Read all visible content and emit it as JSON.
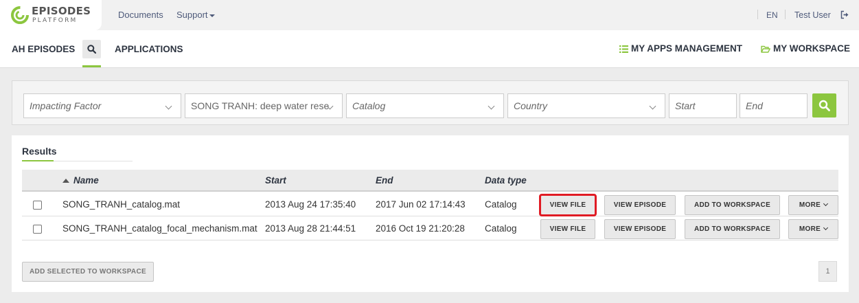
{
  "header": {
    "logo_line1": "EPISODES",
    "logo_line2": "PLATFORM",
    "links": [
      "Documents",
      "Support"
    ],
    "language": "EN",
    "user": "Test User"
  },
  "nav": {
    "left": [
      "AH EPISODES",
      "APPLICATIONS"
    ],
    "right": [
      "MY APPS MANAGEMENT",
      "MY WORKSPACE"
    ],
    "active": "search"
  },
  "filters": {
    "impacting_factor": "Impacting Factor",
    "episode": "SONG TRANH: deep water rese",
    "catalog": "Catalog",
    "country": "Country",
    "start": "Start",
    "end": "End"
  },
  "results": {
    "title": "Results",
    "columns": [
      "Name",
      "Start",
      "End",
      "Data type"
    ],
    "rows": [
      {
        "name": "SONG_TRANH_catalog.mat",
        "start": "2013 Aug 24 17:35:40",
        "end": "2017 Jun 02 17:14:43",
        "type": "Catalog"
      },
      {
        "name": "SONG_TRANH_catalog_focal_mechanism.mat",
        "start": "2013 Aug 28 21:44:51",
        "end": "2016 Oct 19 21:20:28",
        "type": "Catalog"
      }
    ],
    "buttons": {
      "view_file": "VIEW FILE",
      "view_episode": "VIEW EPISODE",
      "add_to_workspace": "ADD TO WORKSPACE",
      "more": "MORE"
    },
    "add_selected": "ADD SELECTED TO WORKSPACE",
    "page": "1"
  },
  "colors": {
    "accent": "#8cc63f",
    "highlight": "#e01b24"
  }
}
